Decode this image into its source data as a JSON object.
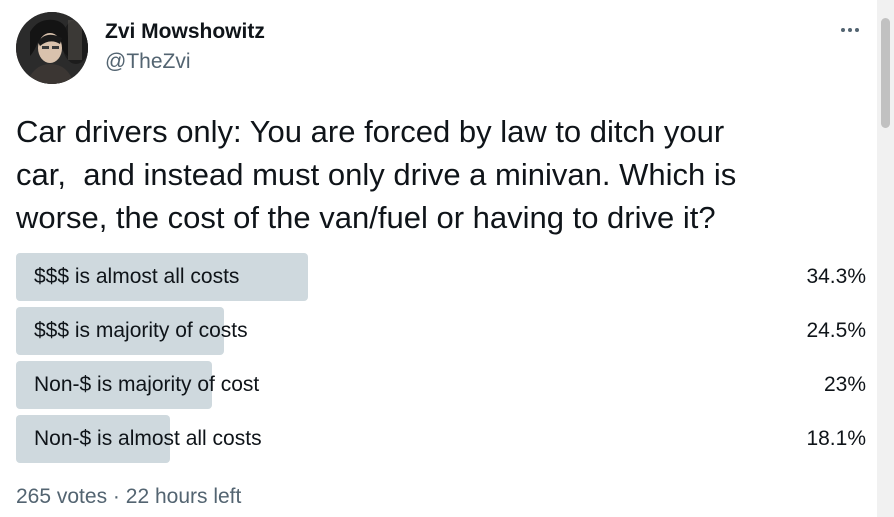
{
  "author": {
    "name": "Zvi Mowshowitz",
    "handle": "@TheZvi"
  },
  "icons": {
    "more": "more-horizontal-icon",
    "avatar": "profile-photo"
  },
  "tweet": {
    "text": "Car drivers only: You are forced by law to ditch your\ncar,  and instead must only drive a minivan. Which is\nworse, the cost of the van/fuel or having to drive it?"
  },
  "poll": {
    "options": [
      {
        "label": "$$$ is almost all costs",
        "percent_text": "34.3%",
        "percent": 34.3
      },
      {
        "label": "$$$ is majority of costs",
        "percent_text": "24.5%",
        "percent": 24.5
      },
      {
        "label": "Non-$ is majority of cost",
        "percent_text": "23%",
        "percent": 23
      },
      {
        "label": "Non-$ is almost all costs",
        "percent_text": "18.1%",
        "percent": 18.1
      }
    ],
    "votes": "265 votes",
    "separator": "·",
    "time_left": "22 hours left"
  },
  "colors": {
    "bar_fill": "#cfd9de",
    "text_primary": "#0f1419",
    "text_secondary": "#536471"
  }
}
